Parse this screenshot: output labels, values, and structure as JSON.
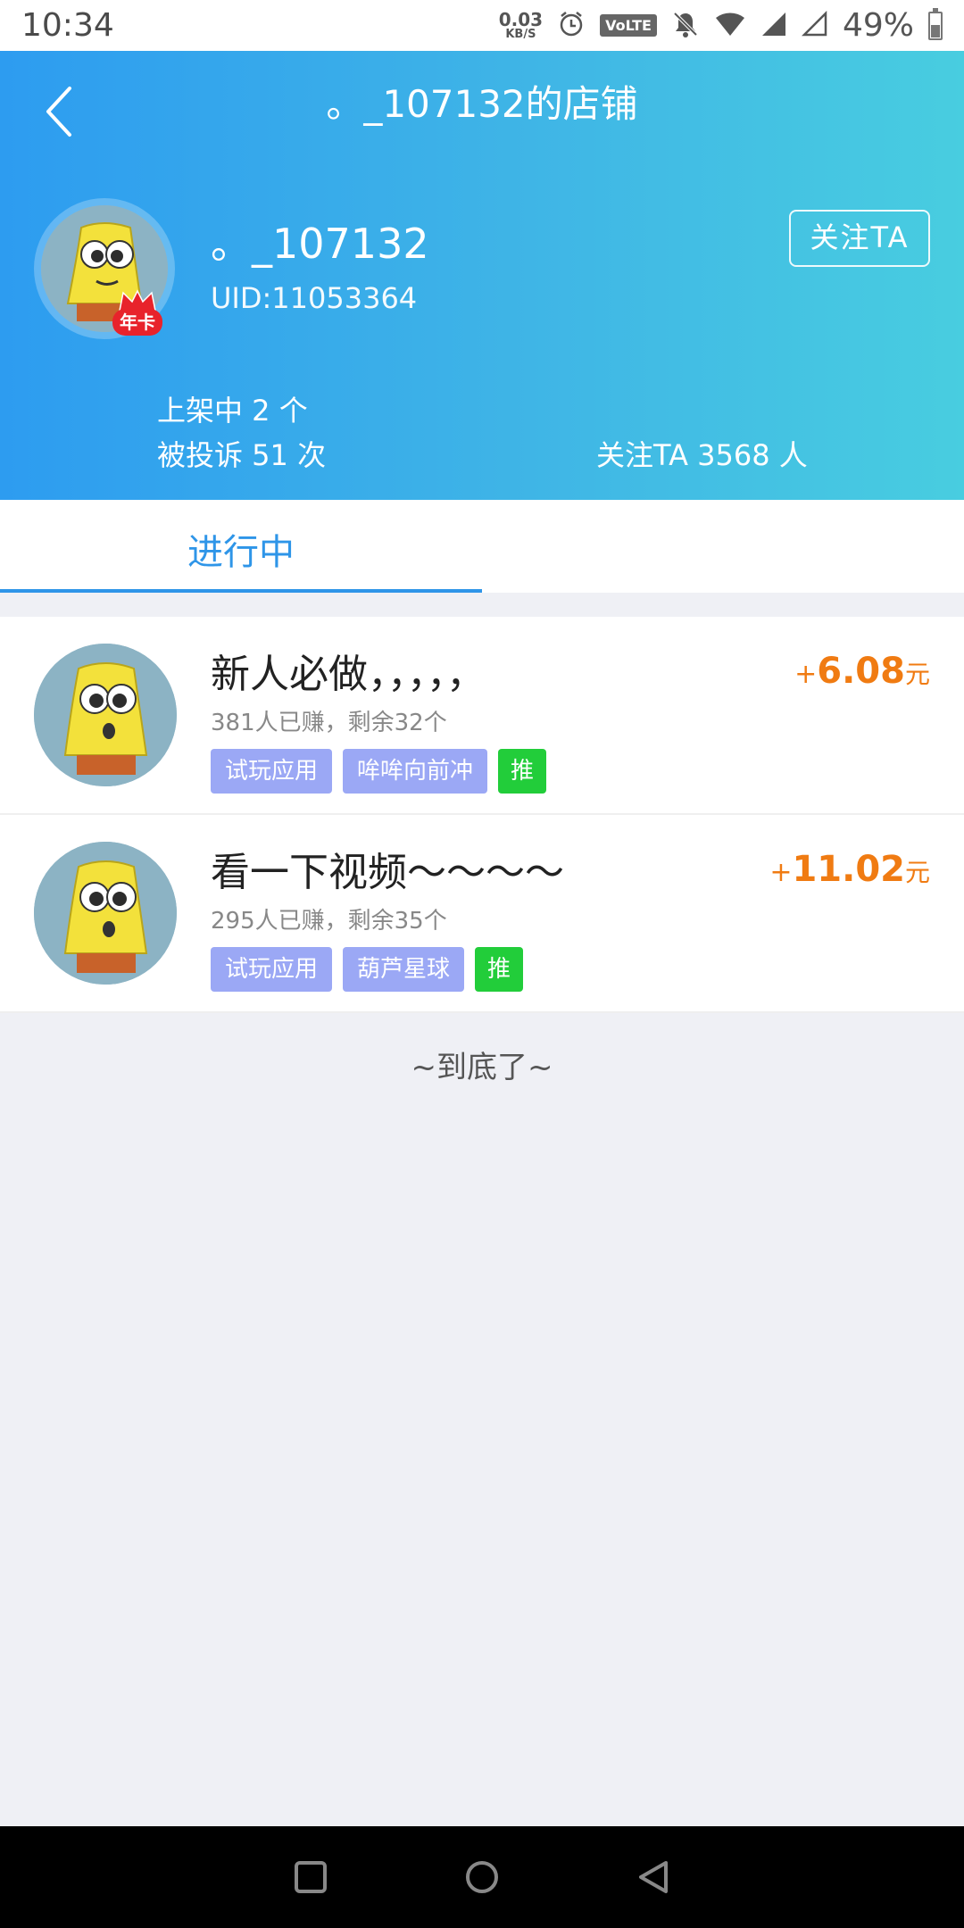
{
  "status_bar": {
    "time": "10:34",
    "net_speed_value": "0.03",
    "net_speed_unit": "KB/S",
    "volte": "VoLTE",
    "battery": "49%",
    "battery_level": 0.49
  },
  "header": {
    "title": "。_107132的店铺",
    "shop_name": "。_107132",
    "uid": "UID:11053364",
    "follow_button": "关注TA",
    "vip_badge": "年卡",
    "stats": {
      "listed": "上架中 2 个",
      "complaints": "被投诉 51 次",
      "followers": "关注TA 3568 人"
    }
  },
  "tabs": [
    {
      "label": "进行中",
      "active": true
    }
  ],
  "tasks": [
    {
      "title": "新人必做，，，，，",
      "subtitle": "381人已赚，剩余32个",
      "tags": [
        "试玩应用",
        "哞哞向前冲"
      ],
      "recommend_tag": "推",
      "price_plus": "+",
      "price": "6.08",
      "price_unit": "元"
    },
    {
      "title": "看一下视频～～～～",
      "subtitle": "295人已赚，剩余35个",
      "tags": [
        "试玩应用",
        "葫芦星球"
      ],
      "recommend_tag": "推",
      "price_plus": "+",
      "price": "11.02",
      "price_unit": "元"
    }
  ],
  "end_text": "~到底了~",
  "colors": {
    "accent": "#2e95e8",
    "price": "#f07b12",
    "tag": "#9ba8f5",
    "recommend": "#22cd3a"
  },
  "icons": {
    "back": "chevron-left-icon",
    "nav_recent": "square-icon",
    "nav_home": "circle-icon",
    "nav_back": "triangle-back-icon"
  }
}
